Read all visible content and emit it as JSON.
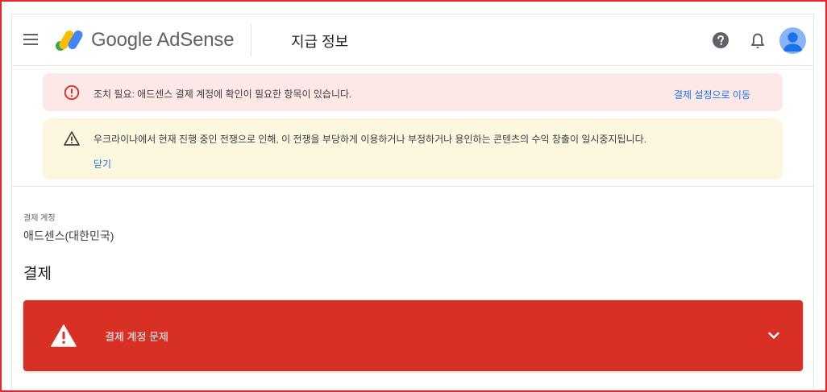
{
  "header": {
    "logo_text": "Google AdSense",
    "page_title": "지급 정보"
  },
  "banners": {
    "error": {
      "text": "조치 필요: 애드센스 결제 계정에 확인이 필요한 항목이 있습니다.",
      "link": "결제 설정으로 이동"
    },
    "warning": {
      "text": "우크라이나에서 현재 진행 중인 전쟁으로 인해, 이 전쟁을 부당하게 이용하거나 부정하거나 용인하는 콘텐츠의 수익 창출이 일시중지됩니다.",
      "link": "닫기"
    }
  },
  "account": {
    "label": "결제 계정",
    "value": "애드센스(대한민국)"
  },
  "section": {
    "title": "결제"
  },
  "alert": {
    "text": "결제 계정 문제"
  },
  "colors": {
    "alert_red": "#d93025",
    "link_blue": "#1a73e8",
    "error_banner_bg": "#fce8e6",
    "warning_banner_bg": "#fef7e0"
  }
}
